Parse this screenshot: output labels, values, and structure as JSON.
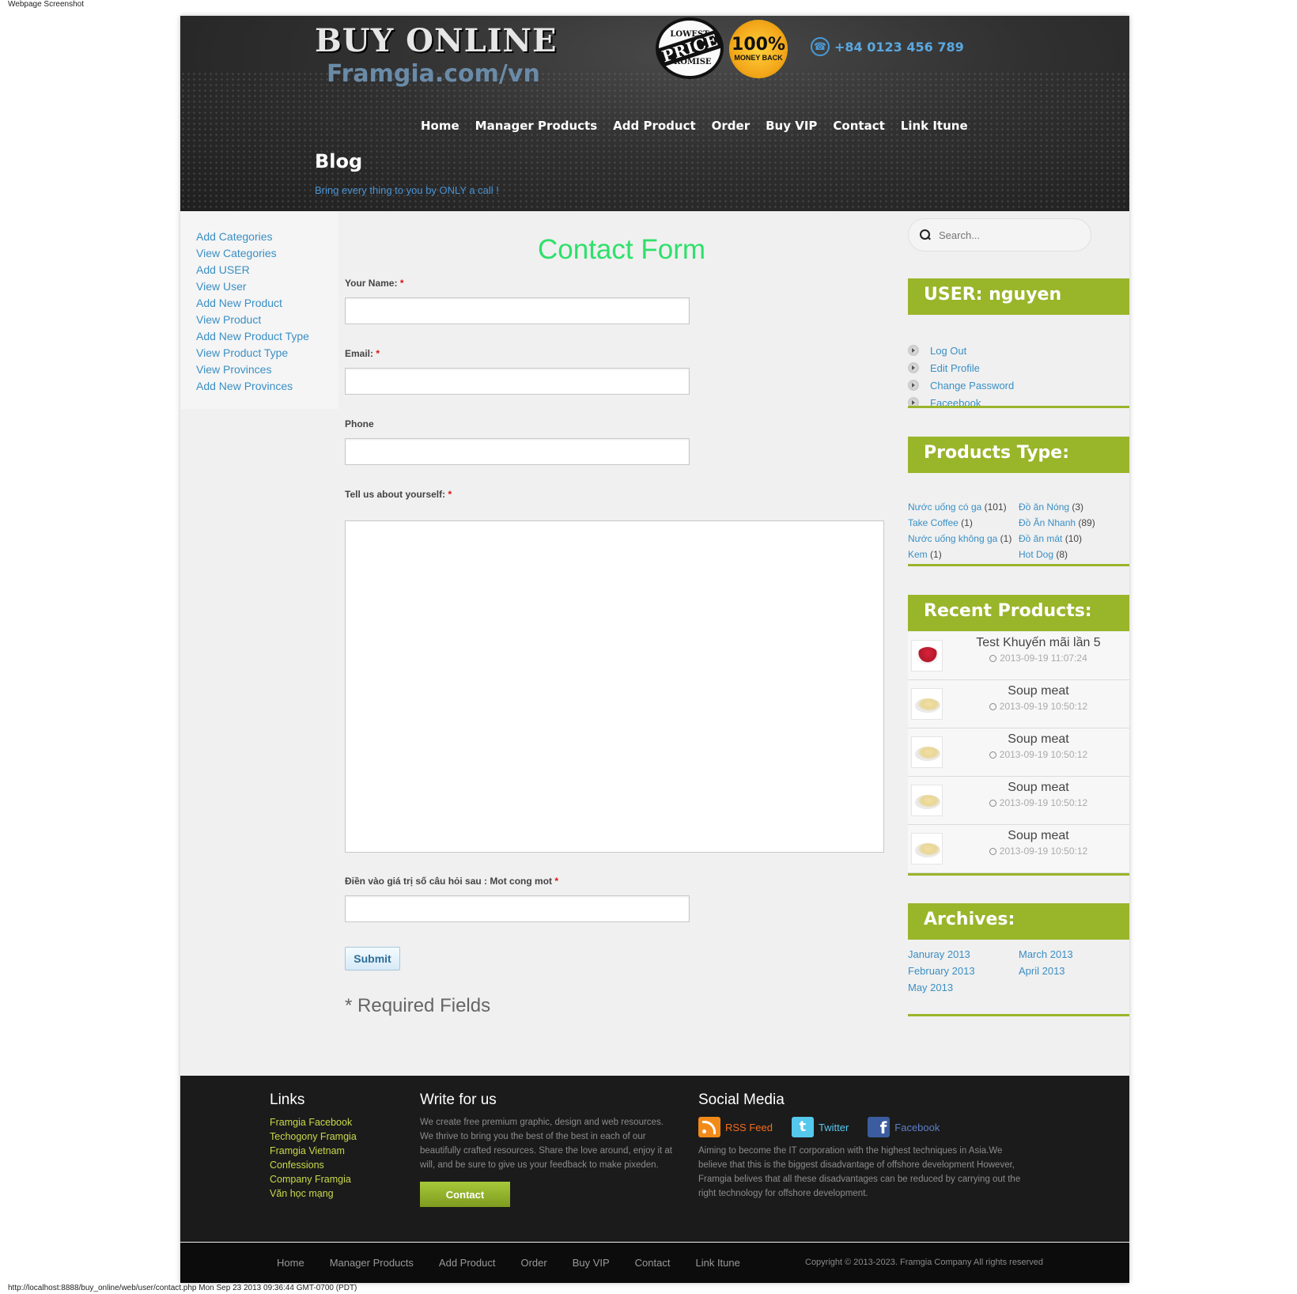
{
  "screenshot": {
    "label": "Webpage Screenshot",
    "footer": "http://localhost:8888/buy_online/web/user/contact.php Mon Sep 23 2013 09:36:44 GMT-0700 (PDT)"
  },
  "header": {
    "logo_title": "BUY ONLINE",
    "logo_sub": "Framgia.com/vn",
    "badge_price": {
      "top": "LOWEST",
      "middle": "PRICE",
      "bottom": "PROMISE"
    },
    "badge_money": {
      "big": "100%",
      "small": "MONEY BACK"
    },
    "phone": "+84 0123 456 789",
    "phone_icon": "phone-icon",
    "nav": [
      "Home",
      "Manager Products",
      "Add Product",
      "Order",
      "Buy VIP",
      "Contact",
      "Link Itune"
    ],
    "blog_title": "Blog",
    "tagline": "Bring every thing to you by ONLY a call !"
  },
  "leftnav": [
    "Add Categories",
    "View Categories",
    "Add USER",
    "View User",
    "Add New Product",
    "View Product",
    "Add New Product Type",
    "View Product Type",
    "View Provinces",
    "Add New Provinces"
  ],
  "form": {
    "title": "Contact Form",
    "name_label": "Your Name:",
    "email_label": "Email:",
    "phone_label": "Phone",
    "about_label": "Tell us about yourself:",
    "captcha_label": "Điền vào giá trị số câu hỏi sau : Mot cong mot",
    "required_mark": "*",
    "submit": "Submit",
    "required_note": "* Required Fields"
  },
  "sidebar": {
    "search_placeholder": "Search...",
    "user_title": "USER: nguyen",
    "user_links": [
      "Log Out",
      "Edit Profile",
      "Change Password",
      "Faceebook"
    ],
    "ptype_title": "Products Type:",
    "ptype": [
      {
        "name": "Nước uống có ga",
        "count": "(101)"
      },
      {
        "name": "Đồ ăn Nóng",
        "count": "(3)"
      },
      {
        "name": "Take Coffee",
        "count": "(1)"
      },
      {
        "name": "Đồ Ăn Nhanh",
        "count": "(89)"
      },
      {
        "name": "Nước uống không ga",
        "count": "(1)"
      },
      {
        "name": "Đồ ăn mát",
        "count": "(10)"
      },
      {
        "name": "Kem",
        "count": "(1)"
      },
      {
        "name": "Hot Dog",
        "count": "(8)"
      }
    ],
    "recent_title": "Recent Products:",
    "recent": [
      {
        "name": "Test Khuyến mãi lần 5",
        "date": "2013-09-19 11:07:24"
      },
      {
        "name": "Soup meat",
        "date": "2013-09-19 10:50:12"
      },
      {
        "name": "Soup meat",
        "date": "2013-09-19 10:50:12"
      },
      {
        "name": "Soup meat",
        "date": "2013-09-19 10:50:12"
      },
      {
        "name": "Soup meat",
        "date": "2013-09-19 10:50:12"
      }
    ],
    "archives_title": "Archives:",
    "archives": [
      "Januray 2013",
      "March 2013",
      "February 2013",
      "April 2013",
      "May 2013"
    ]
  },
  "footer": {
    "links_title": "Links",
    "links": [
      "Framgia Facebook",
      "Techogony Framgia",
      "Framgia Vietnam",
      "Confessions",
      "Company Framgia",
      "Văn học mạng"
    ],
    "write_title": "Write for us",
    "write_text": "We create free premium graphic, design and web resources. We thrive to bring you the best of the best in each of our beautifully crafted resources. Share the love around, enjoy it at will, and be sure to give us your feedback to make pixeden.",
    "write_button": "Contact",
    "social_title": "Social Media",
    "social": [
      {
        "label": "RSS Feed",
        "color": "#f26b1d"
      },
      {
        "label": "Twitter",
        "color": "#55c8ee"
      },
      {
        "label": "Facebook",
        "color": "#5b7fc6"
      }
    ],
    "social_text": "Aiming to become the IT corporation with the highest techniques in Asia.We believe that this is the biggest disadvantage of offshore development However, Framgia belives that all these disadvantages can be reduced by carrying out the right technology for offshore development.",
    "bottom_nav": [
      "Home",
      "Manager Products",
      "Add Product",
      "Order",
      "Buy VIP",
      "Contact",
      "Link Itune"
    ],
    "copyright": "Copyright © 2013-2023. Framgia Company All rights reserved"
  },
  "colors": {
    "accent_green": "#99b52a",
    "link_blue": "#3a8fc4",
    "form_title_green": "#2ee06a",
    "required_red": "#dd1111"
  }
}
